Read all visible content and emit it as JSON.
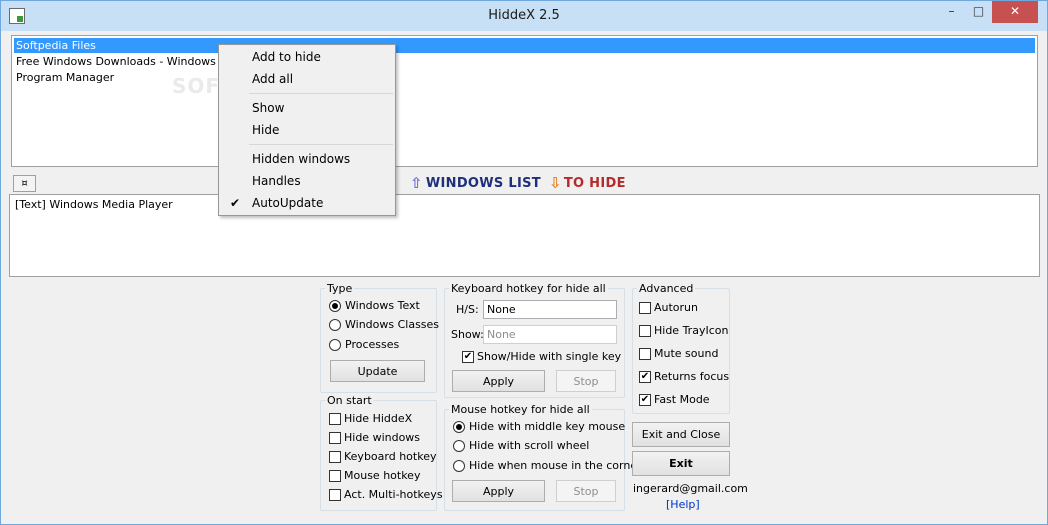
{
  "window": {
    "title": "HiddeX 2.5",
    "min": "–",
    "max": "□",
    "close": "✕"
  },
  "windows_list": {
    "items": [
      {
        "label": "Softpedia Files",
        "selected": true
      },
      {
        "label": "Free Windows Downloads - Windows Inter",
        "selected": false
      },
      {
        "label": "Program Manager",
        "selected": false
      }
    ]
  },
  "toolbar": {
    "pin_symbol": "¤"
  },
  "banner": {
    "arrow_up": "⇧",
    "windows_list": "WINDOWS LIST",
    "arrow_down": "⇩",
    "to_hide": "TO HIDE"
  },
  "to_hide_list": {
    "items": [
      {
        "label": "[Text] Windows Media Player"
      }
    ]
  },
  "context_menu": {
    "add_to_hide": "Add to hide",
    "add_all": "Add all",
    "show": "Show",
    "hide": "Hide",
    "hidden_windows": "Hidden windows",
    "handles": "Handles",
    "autoupdate": "AutoUpdate",
    "check_mark": "✔"
  },
  "type_group": {
    "legend": "Type",
    "options": [
      "Windows Text",
      "Windows Classes",
      "Processes"
    ],
    "selected": "Windows Text",
    "update": "Update"
  },
  "on_start_group": {
    "legend": "On start",
    "options": [
      "Hide HiddeX",
      "Hide windows",
      "Keyboard hotkey",
      "Mouse hotkey",
      "Act. Multi-hotkeys"
    ]
  },
  "keyboard_group": {
    "legend": "Keyboard hotkey for hide all",
    "hs_label": "H/S:",
    "hs_value": "None",
    "show_label": "Show:",
    "show_value": "None",
    "single_key": "Show/Hide with single key",
    "apply": "Apply",
    "stop": "Stop"
  },
  "mouse_group": {
    "legend": "Mouse hotkey for hide all",
    "options": [
      "Hide with middle key mouse",
      "Hide with scroll wheel",
      "Hide when mouse in the corner"
    ],
    "selected": "Hide with middle key mouse",
    "apply": "Apply",
    "stop": "Stop"
  },
  "advanced_group": {
    "legend": "Advanced",
    "options": [
      "Autorun",
      "Hide TrayIcon",
      "Mute sound",
      "Returns focus",
      "Fast Mode"
    ],
    "checked": [
      "Returns focus",
      "Fast Mode"
    ],
    "check_mark": "✔"
  },
  "actions": {
    "exit_close": "Exit and Close",
    "exit": "Exit",
    "email": "ingerard@gmail.com",
    "help": "[Help]"
  },
  "watermark": "SOFTPEDIA"
}
